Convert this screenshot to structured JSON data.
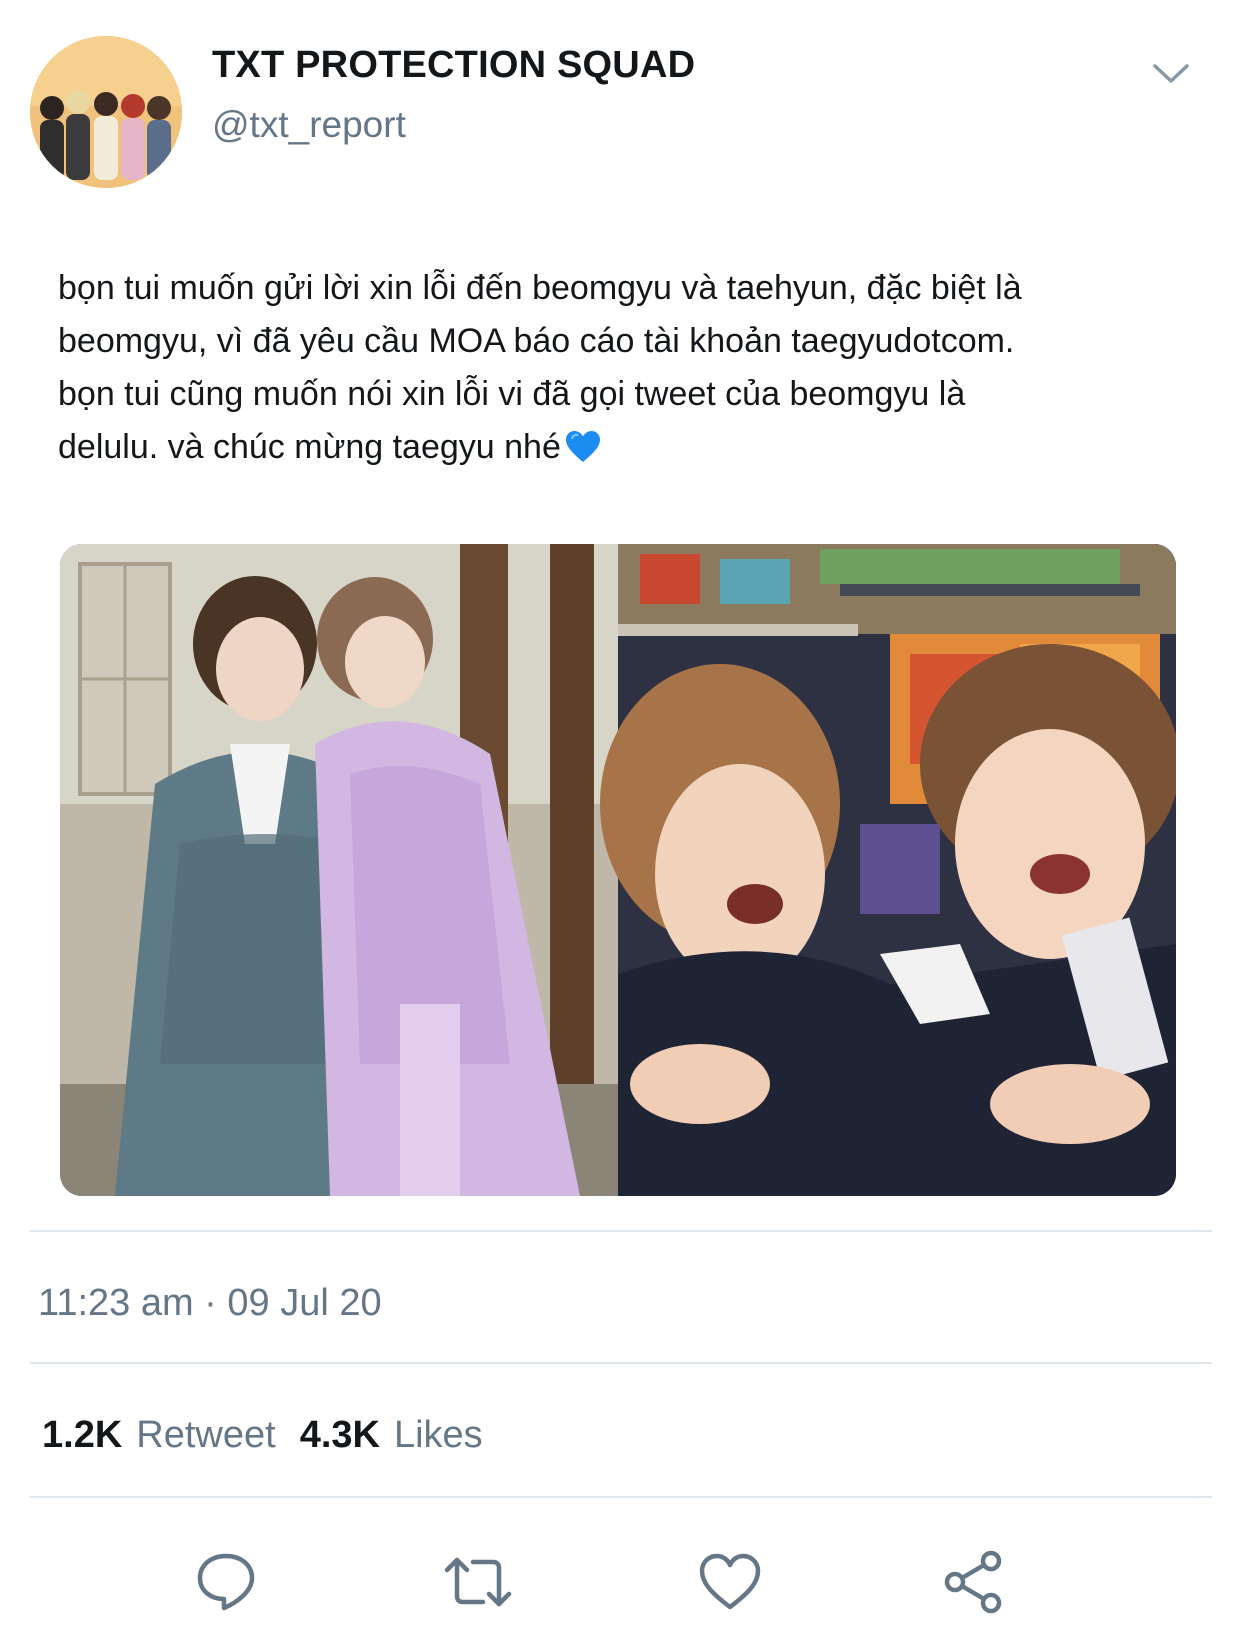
{
  "account": {
    "display_name": "TXT PROTECTION SQUAD",
    "handle": "@txt_report"
  },
  "tweet": {
    "text": "bọn tui muốn gửi lời xin lỗi đến beomgyu và taehyun, đặc biệt là\nbeomgyu, vì đã yêu cầu MOA báo cáo tài khoản taegyudotcom.\nbọn tui cũng muốn nói xin lỗi vi đã gọi tweet của beomgyu là\ndelulu. và chúc mừng taegyu nhé",
    "emoji": "blue-heart",
    "timestamp": "11:23 am · 09 Jul 20"
  },
  "stats": {
    "retweets_count": "1.2K",
    "retweets_label": "Retweet",
    "likes_count": "4.3K",
    "likes_label": "Likes"
  },
  "actions": [
    {
      "name": "reply",
      "icon": "reply-icon"
    },
    {
      "name": "retweet",
      "icon": "retweet-icon"
    },
    {
      "name": "like",
      "icon": "heart-icon"
    },
    {
      "name": "share",
      "icon": "share-icon"
    }
  ],
  "colors": {
    "text_primary": "#14171a",
    "text_secondary": "#657786",
    "icon_gray": "#657786",
    "divider": "#e1e8ed",
    "heart_emoji": "#1d8cf0"
  }
}
